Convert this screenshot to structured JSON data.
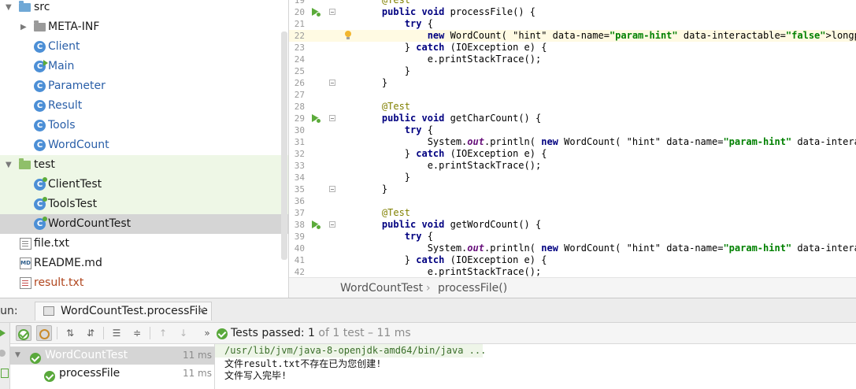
{
  "project_tree": {
    "items": [
      {
        "label": "src",
        "icon": "folder-icon",
        "depth": 0,
        "expanded": true
      },
      {
        "label": "META-INF",
        "icon": "folder-icon",
        "depth": 1,
        "expanded": false
      },
      {
        "label": "Client",
        "icon": "class-icon",
        "depth": 2
      },
      {
        "label": "Main",
        "icon": "main-class-icon",
        "depth": 2
      },
      {
        "label": "Parameter",
        "icon": "class-icon",
        "depth": 2
      },
      {
        "label": "Result",
        "icon": "class-icon",
        "depth": 2
      },
      {
        "label": "Tools",
        "icon": "class-icon",
        "depth": 2
      },
      {
        "label": "WordCount",
        "icon": "class-icon",
        "depth": 2
      },
      {
        "label": "test",
        "icon": "test-folder-icon",
        "depth": 0,
        "expanded": true
      },
      {
        "label": "ClientTest",
        "icon": "test-class-icon",
        "depth": 2
      },
      {
        "label": "ToolsTest",
        "icon": "test-class-icon",
        "depth": 2
      },
      {
        "label": "WordCountTest",
        "icon": "test-class-icon",
        "depth": 2,
        "selected": true
      },
      {
        "label": "file.txt",
        "icon": "text-file-icon",
        "depth": 1
      },
      {
        "label": "README.md",
        "icon": "markdown-file-icon",
        "depth": 1
      },
      {
        "label": "result.txt",
        "icon": "text-file-icon",
        "depth": 1,
        "modified": true
      }
    ]
  },
  "editor": {
    "lines": [
      {
        "num": "19",
        "code": "    @Test"
      },
      {
        "num": "20",
        "code": "    public void processFile() {"
      },
      {
        "num": "21",
        "code": "        try {"
      },
      {
        "num": "22",
        "code": "            new WordCount( longparas: \"arfew\").processFile();"
      },
      {
        "num": "23",
        "code": "        } catch (IOException e) {"
      },
      {
        "num": "24",
        "code": "            e.printStackTrace();"
      },
      {
        "num": "25",
        "code": "        }"
      },
      {
        "num": "26",
        "code": "    }"
      },
      {
        "num": "27",
        "code": ""
      },
      {
        "num": "28",
        "code": "    @Test"
      },
      {
        "num": "29",
        "code": "    public void getCharCount() {"
      },
      {
        "num": "30",
        "code": "        try {"
      },
      {
        "num": "31",
        "code": "            System.out.println( new WordCount( longparas: \"arfew\").getCharCount( textData: \"awsr\")"
      },
      {
        "num": "32",
        "code": "        } catch (IOException e) {"
      },
      {
        "num": "33",
        "code": "            e.printStackTrace();"
      },
      {
        "num": "34",
        "code": "        }"
      },
      {
        "num": "35",
        "code": "    }"
      },
      {
        "num": "36",
        "code": ""
      },
      {
        "num": "37",
        "code": "    @Test"
      },
      {
        "num": "38",
        "code": "    public void getWordCount() {"
      },
      {
        "num": "39",
        "code": "        try {"
      },
      {
        "num": "40",
        "code": "            System.out.println( new WordCount( longparas: \"arfew\").getWordCount( HasStopWords: fals"
      },
      {
        "num": "41",
        "code": "        } catch (IOException e) {"
      },
      {
        "num": "42",
        "code": "            e.printStackTrace();"
      }
    ],
    "breadcrumb": {
      "class": "WordCountTest",
      "separator": "›",
      "method": "processFile()"
    }
  },
  "run_panel": {
    "label": "Run:",
    "tab_label": "WordCountTest.processFile",
    "tab_close": "×",
    "status": {
      "prefix": "Tests passed:",
      "count": "1",
      "detail": "of 1 test – 11 ms"
    },
    "tests": [
      {
        "name": "WordCountTest",
        "time": "11 ms"
      },
      {
        "name": "processFile",
        "time": "11 ms"
      }
    ],
    "console": {
      "command": "/usr/lib/jvm/java-8-openjdk-amd64/bin/java ...",
      "output": [
        "文件result.txt不存在已为您创建!",
        "文件写入完毕!"
      ]
    }
  },
  "colors": {
    "keyword": "#000080",
    "annotation": "#808000",
    "string": "#008000",
    "selection": "#1d5b98",
    "pass_green": "#59a83b"
  }
}
